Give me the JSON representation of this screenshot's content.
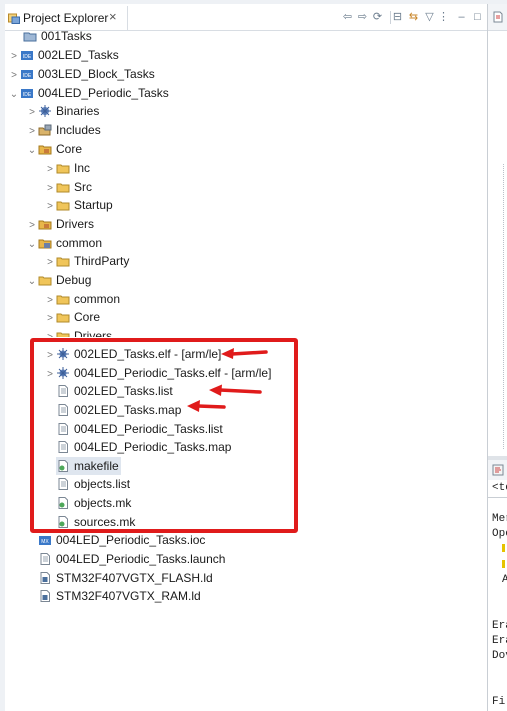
{
  "view": {
    "title": "Project Explorer",
    "close_glyph": "×"
  },
  "toolbar": {
    "back": "⇦",
    "forward": "⇨",
    "refresh": "⟳",
    "collapse": "⊟",
    "link": "⇆",
    "filter": "▽",
    "menu": "⋮",
    "minimize": "‒",
    "maximize": "□"
  },
  "tree": [
    {
      "label": "001Tasks",
      "icon": "project-icon"
    },
    {
      "label": "002LED_Tasks",
      "icon": "ide-project-icon"
    },
    {
      "label": "003LED_Block_Tasks",
      "icon": "ide-project-icon"
    },
    {
      "label": "004LED_Periodic_Tasks",
      "icon": "ide-project-icon"
    },
    {
      "label": "Binaries",
      "icon": "binaries-icon"
    },
    {
      "label": "Includes",
      "icon": "includes-icon"
    },
    {
      "label": "Core",
      "icon": "source-folder-icon"
    },
    {
      "label": "Inc",
      "icon": "folder-icon"
    },
    {
      "label": "Src",
      "icon": "folder-icon"
    },
    {
      "label": "Startup",
      "icon": "folder-icon"
    },
    {
      "label": "Drivers",
      "icon": "source-folder-icon"
    },
    {
      "label": "common",
      "icon": "linked-folder-icon"
    },
    {
      "label": "ThirdParty",
      "icon": "folder-icon"
    },
    {
      "label": "Debug",
      "icon": "folder-icon"
    },
    {
      "label": "common",
      "icon": "folder-icon"
    },
    {
      "label": "Core",
      "icon": "folder-icon"
    },
    {
      "label": "Drivers",
      "icon": "folder-icon"
    },
    {
      "label": "002LED_Tasks.elf - [arm/le]",
      "icon": "binary-elf-icon"
    },
    {
      "label": "004LED_Periodic_Tasks.elf - [arm/le]",
      "icon": "binary-elf-icon"
    },
    {
      "label": "002LED_Tasks.list",
      "icon": "text-file-icon"
    },
    {
      "label": "002LED_Tasks.map",
      "icon": "text-file-icon"
    },
    {
      "label": "004LED_Periodic_Tasks.list",
      "icon": "text-file-icon"
    },
    {
      "label": "004LED_Periodic_Tasks.map",
      "icon": "text-file-icon"
    },
    {
      "label": "makefile",
      "icon": "makefile-icon"
    },
    {
      "label": "objects.list",
      "icon": "text-file-icon"
    },
    {
      "label": "objects.mk",
      "icon": "makefile-icon"
    },
    {
      "label": "sources.mk",
      "icon": "makefile-icon"
    },
    {
      "label": "004LED_Periodic_Tasks.ioc",
      "icon": "ioc-file-icon"
    },
    {
      "label": "004LED_Periodic_Tasks.launch",
      "icon": "text-file-icon"
    },
    {
      "label": "STM32F407VGTX_FLASH.ld",
      "icon": "linker-script-icon"
    },
    {
      "label": "STM32F407VGTX_RAM.ld",
      "icon": "linker-script-icon"
    }
  ],
  "console_fragments": [
    "<te",
    "Mer",
    "Ope",
    "A",
    "Era",
    "Era",
    "Dov",
    "Fi"
  ],
  "colors": {
    "annotation_red": "#e01b1b",
    "folder_yellow": "#e8b64a",
    "project_blue": "#3a78c8"
  }
}
